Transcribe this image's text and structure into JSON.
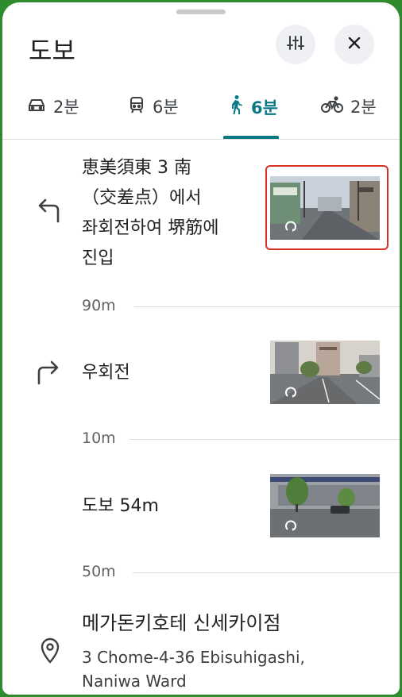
{
  "header": {
    "title": "도보",
    "filter_icon": "tune-icon",
    "close_icon": "close-icon"
  },
  "tabs": [
    {
      "icon": "car-icon",
      "label": "2분"
    },
    {
      "icon": "train-icon",
      "label": "6분"
    },
    {
      "icon": "walk-icon",
      "label": "6분",
      "active": true
    },
    {
      "icon": "bike-icon",
      "label": "2분"
    }
  ],
  "steps": [
    {
      "icon": "turn-left-icon",
      "lines": [
        "恵美須東 3 南",
        "（交差点）에서",
        "좌회전하여 堺筋에",
        "진입"
      ],
      "thumbnail": "street-view-thumbnail"
    },
    {
      "icon": "turn-right-icon",
      "lines": [
        "우회전"
      ],
      "thumbnail": "street-view-thumbnail"
    },
    {
      "icon": "",
      "lines": [
        "도보 54m"
      ],
      "thumbnail": "street-view-thumbnail"
    }
  ],
  "distances": [
    "90m",
    "10m",
    "50m"
  ],
  "destination": {
    "icon": "location-pin-icon",
    "name": "메가돈키호테 신세카이점",
    "address_lines": [
      "3 Chome-4-36 Ebisuhigashi,",
      "Naniwa Ward"
    ]
  },
  "colors": {
    "accent": "#0b7a87",
    "highlight": "#d93025",
    "frame": "#2e8b2e"
  }
}
